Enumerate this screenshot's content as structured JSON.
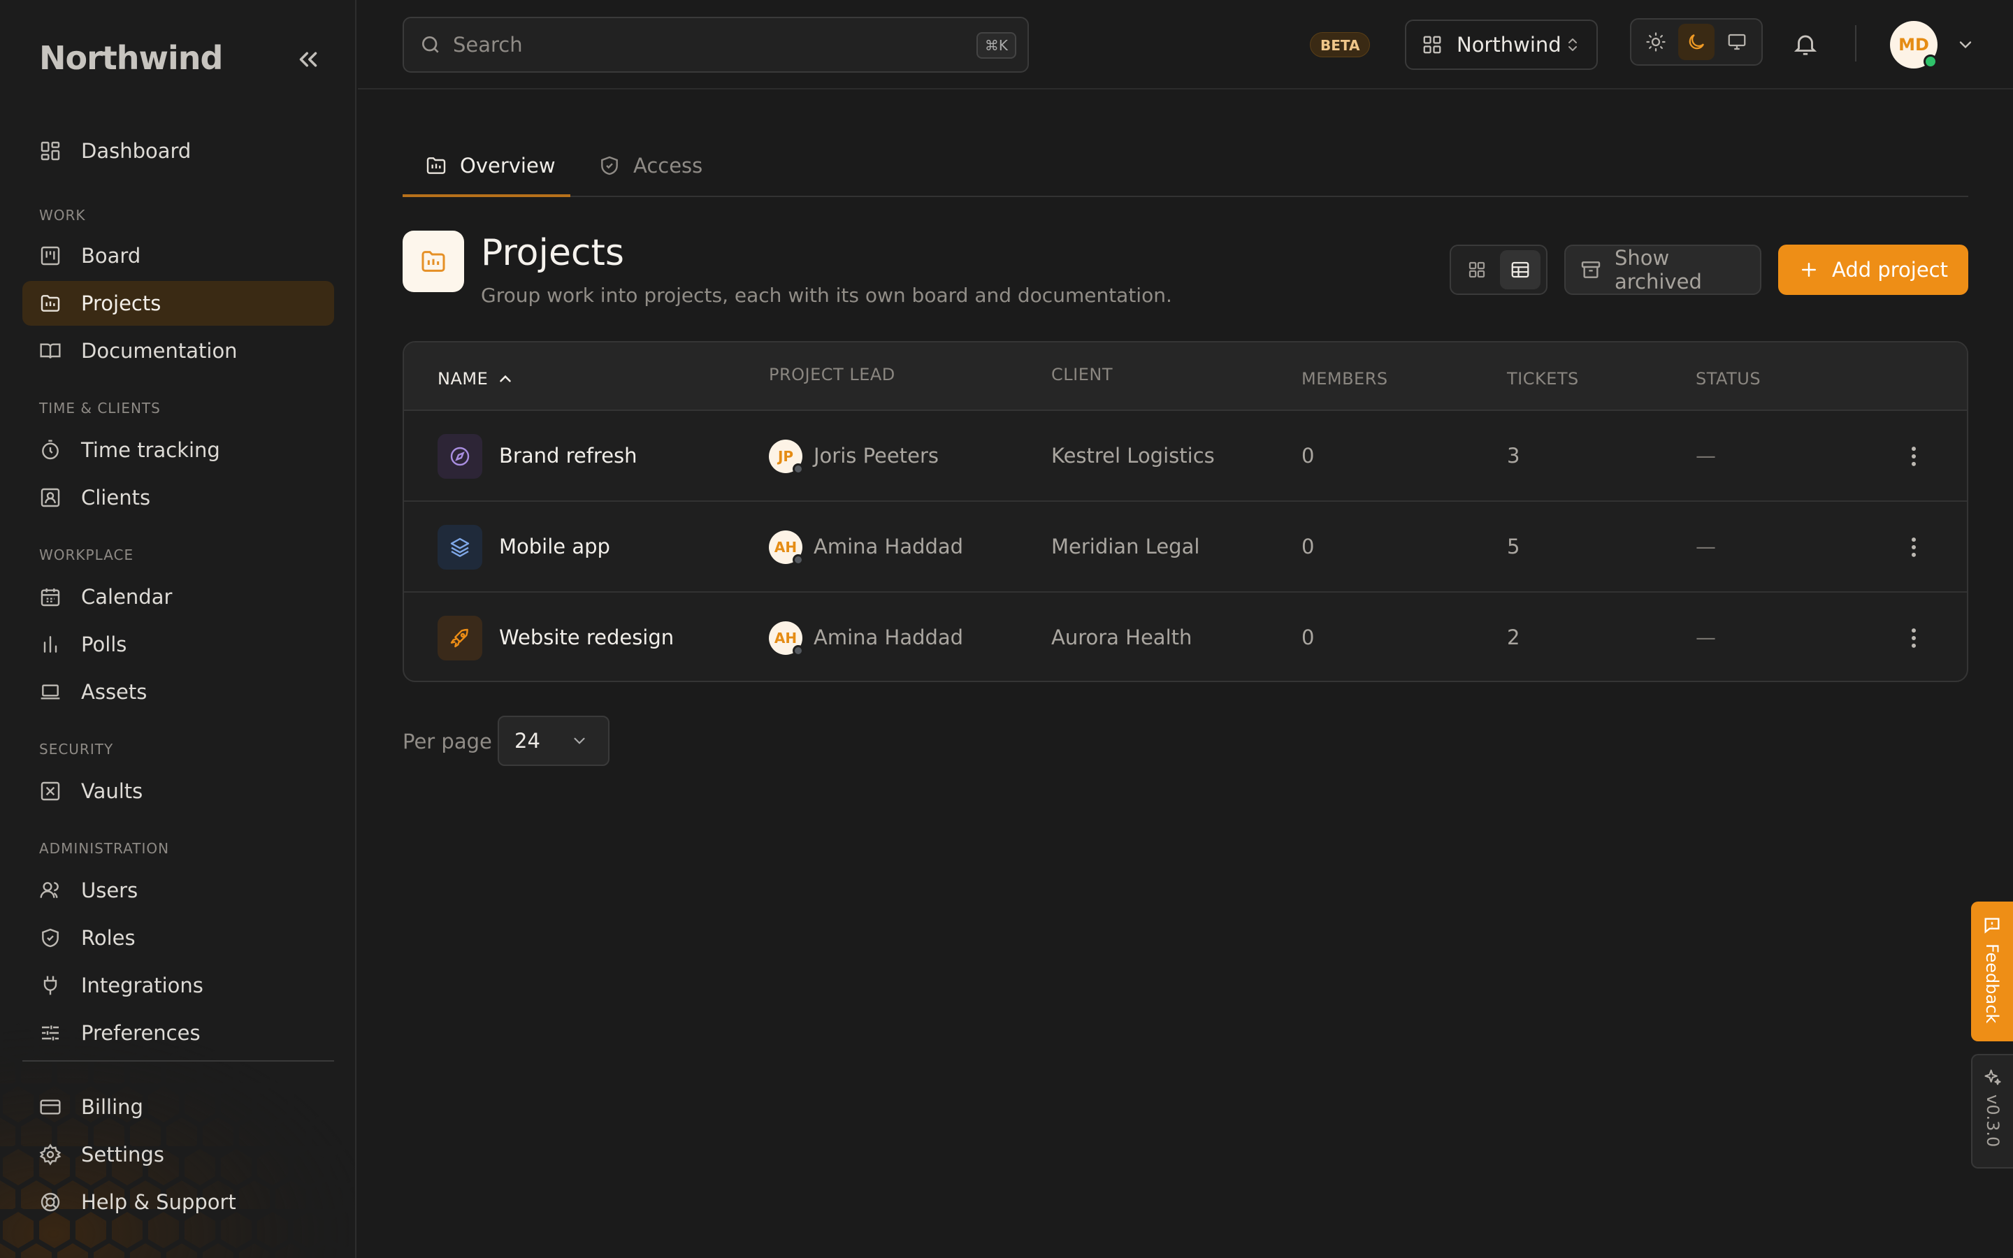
{
  "sidebar": {
    "brand": "Northwind",
    "top_items": [
      {
        "label": "Dashboard",
        "icon": "dashboard-icon"
      }
    ],
    "sections": [
      {
        "title": "WORK",
        "items": [
          {
            "label": "Board",
            "icon": "board-icon"
          },
          {
            "label": "Projects",
            "icon": "projects-folder-icon",
            "active": true
          },
          {
            "label": "Documentation",
            "icon": "book-icon"
          }
        ]
      },
      {
        "title": "TIME & CLIENTS",
        "items": [
          {
            "label": "Time tracking",
            "icon": "stopwatch-icon"
          },
          {
            "label": "Clients",
            "icon": "contact-card-icon"
          }
        ]
      },
      {
        "title": "WORKPLACE",
        "items": [
          {
            "label": "Calendar",
            "icon": "calendar-icon"
          },
          {
            "label": "Polls",
            "icon": "bar-chart-icon"
          },
          {
            "label": "Assets",
            "icon": "laptop-icon"
          }
        ]
      },
      {
        "title": "SECURITY",
        "items": [
          {
            "label": "Vaults",
            "icon": "vault-icon"
          }
        ]
      },
      {
        "title": "ADMINISTRATION",
        "items": [
          {
            "label": "Users",
            "icon": "users-icon"
          },
          {
            "label": "Roles",
            "icon": "shield-icon"
          },
          {
            "label": "Integrations",
            "icon": "plug-icon"
          },
          {
            "label": "Preferences",
            "icon": "sliders-icon"
          }
        ]
      }
    ],
    "bottom_items": [
      {
        "label": "Billing",
        "icon": "credit-card-icon"
      },
      {
        "label": "Settings",
        "icon": "gear-icon"
      },
      {
        "label": "Help & Support",
        "icon": "lifebuoy-icon"
      }
    ]
  },
  "header": {
    "search_placeholder": "Search",
    "search_shortcut": "⌘K",
    "beta_label": "BETA",
    "workspace_name": "Northwind",
    "theme_options": [
      "light",
      "dark",
      "system"
    ],
    "theme_selected": "dark",
    "user_initials": "MD",
    "user_status": "online"
  },
  "tabs": [
    {
      "label": "Overview",
      "icon": "folder-chart-icon",
      "active": true
    },
    {
      "label": "Access",
      "icon": "shield-check-icon",
      "active": false
    }
  ],
  "page": {
    "title": "Projects",
    "subtitle": "Group work into projects, each with its own board and documentation.",
    "view_mode": "table",
    "show_archived_label": "Show archived",
    "add_button_label": "Add project"
  },
  "table": {
    "columns": [
      {
        "label": "NAME",
        "sort": "asc"
      },
      {
        "label": "PROJECT LEAD"
      },
      {
        "label": "CLIENT"
      },
      {
        "label": "MEMBERS"
      },
      {
        "label": "TICKETS"
      },
      {
        "label": "STATUS"
      }
    ],
    "rows": [
      {
        "name": "Brand refresh",
        "icon": "compass-icon",
        "icon_bg": "#2d2536",
        "icon_color": "#a98ee0",
        "lead_initials": "JP",
        "lead": "Joris Peeters",
        "client": "Kestrel Logistics",
        "members": "0",
        "tickets": "3",
        "status": "—"
      },
      {
        "name": "Mobile app",
        "icon": "layers-icon",
        "icon_bg": "#1f2a3a",
        "icon_color": "#7fa8e8",
        "lead_initials": "AH",
        "lead": "Amina Haddad",
        "client": "Meridian Legal",
        "members": "0",
        "tickets": "5",
        "status": "—"
      },
      {
        "name": "Website redesign",
        "icon": "rocket-icon",
        "icon_bg": "#3a2a1a",
        "icon_color": "#ee8e16",
        "lead_initials": "AH",
        "lead": "Amina Haddad",
        "client": "Aurora Health",
        "members": "0",
        "tickets": "2",
        "status": "—"
      }
    ]
  },
  "pagination": {
    "per_page_label": "Per page",
    "per_page_value": "24"
  },
  "floating": {
    "feedback_label": "Feedback",
    "version_label": "v0.3.0"
  },
  "colors": {
    "accent": "#ee8e16",
    "background": "#1b1b1b",
    "active_nav": "#3a2a14"
  }
}
